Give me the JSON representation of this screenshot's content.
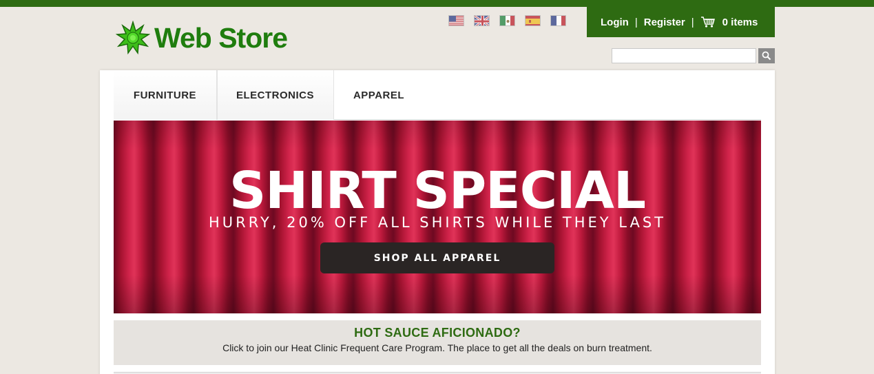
{
  "brand": {
    "name": "Web Store",
    "logo_icon": "green-star-icon",
    "primary_color": "#2e6b12",
    "logo_text_color": "#1f7d0e"
  },
  "languages": [
    {
      "code": "en-US",
      "icon": "us-flag-icon"
    },
    {
      "code": "en-GB",
      "icon": "uk-flag-icon"
    },
    {
      "code": "es-MX",
      "icon": "mexico-flag-icon"
    },
    {
      "code": "es-ES",
      "icon": "spain-flag-icon"
    },
    {
      "code": "fr-FR",
      "icon": "france-flag-icon"
    }
  ],
  "userbar": {
    "login_label": "Login",
    "register_label": "Register",
    "separator": "|",
    "cart_icon": "shopping-cart-icon",
    "cart_label": "0 items"
  },
  "search": {
    "value": "",
    "button_icon": "magnifier-icon"
  },
  "nav": {
    "items": [
      {
        "label": "FURNITURE"
      },
      {
        "label": "ELECTRONICS"
      },
      {
        "label": "APPAREL"
      }
    ]
  },
  "banner": {
    "title": "SHIRT SPECIAL",
    "subtitle": "HURRY, 20% OFF ALL SHIRTS WHILE THEY LAST",
    "button_label": "SHOP ALL APPAREL",
    "button_color": "#2a2524"
  },
  "promo": {
    "title": "HOT SAUCE AFICIONADO?",
    "text": "Click to join our Heat Clinic Frequent Care Program. The place to get all the deals on burn treatment."
  }
}
